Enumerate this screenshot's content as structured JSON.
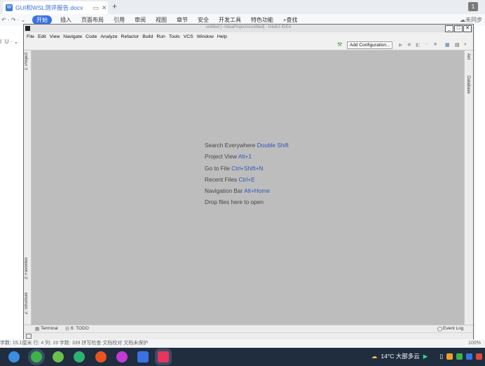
{
  "wps": {
    "tab_title": "GUI和WSL测评报告.docx",
    "ribbon_tabs": [
      "开始",
      "插入",
      "页面布局",
      "引用",
      "审阅",
      "视图",
      "章节",
      "安全",
      "开发工具",
      "特色功能"
    ],
    "search_label": "查找",
    "sync_label": "未同步",
    "badge": "1",
    "status_left": "字数: 15.1厘米   行: 4   列: 19   字数: 339   拼写检查   文档校对   文档未保护",
    "status_right": "100%"
  },
  "taskbar": {
    "weather": "14°C 大部多云"
  },
  "ide": {
    "title": "untitled [~/IdeaProjects/untitled] - IntelliJ IDEA",
    "menu": [
      "File",
      "Edit",
      "View",
      "Navigate",
      "Code",
      "Analyze",
      "Refactor",
      "Build",
      "Run",
      "Tools",
      "VCS",
      "Window",
      "Help"
    ],
    "add_configuration": "Add Configuration...",
    "left_tools": {
      "project": "1: Project",
      "favorites": "2: Favorites",
      "structure": "Z: Structure"
    },
    "right_tools": {
      "ant": "Ant",
      "database": "Database"
    },
    "hints": [
      {
        "label": "Search Everywhere",
        "key": "Double Shift"
      },
      {
        "label": "Project View",
        "key": "Alt+1"
      },
      {
        "label": "Go to File",
        "key": "Ctrl+Shift+N"
      },
      {
        "label": "Recent Files",
        "key": "Ctrl+E"
      },
      {
        "label": "Navigation Bar",
        "key": "Alt+Home"
      },
      {
        "label": "Drop files here to open",
        "key": ""
      }
    ],
    "bottom_tools": {
      "terminal": "Terminal",
      "todo": "6: TODO",
      "event_log": "Event Log"
    }
  }
}
